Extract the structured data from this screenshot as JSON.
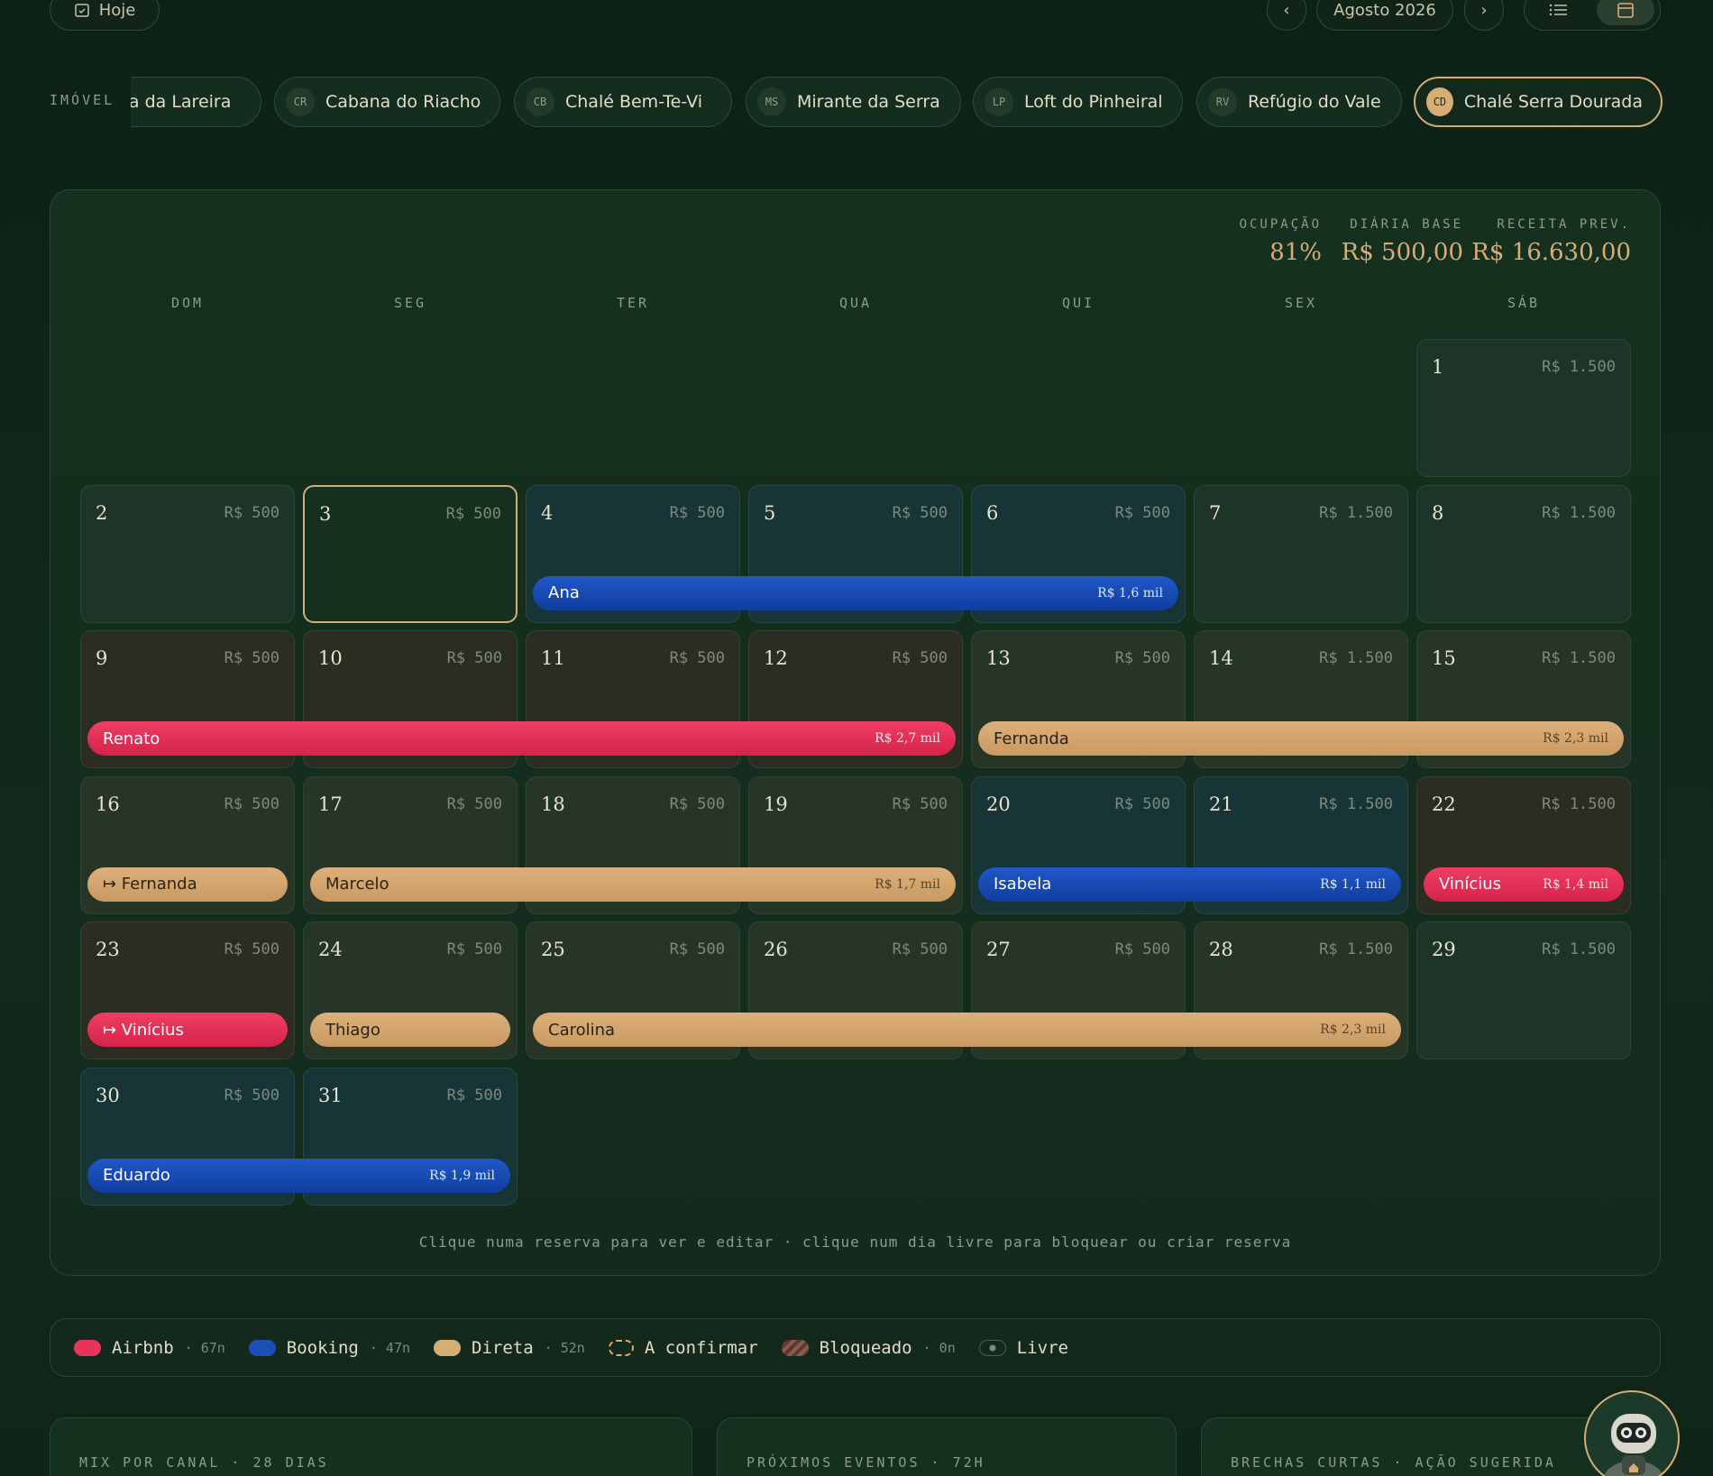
{
  "toolbar": {
    "today_label": "Hoje",
    "month_label": "Agosto 2026",
    "prev_icon": "chevron-left-icon",
    "next_icon": "chevron-right-icon",
    "views": [
      "list-view-icon",
      "calendar-view-icon"
    ]
  },
  "properties": {
    "label": "IMÓVEL",
    "items": [
      {
        "abbr": "",
        "name": "sa da Lareira"
      },
      {
        "abbr": "CR",
        "name": "Cabana do Riacho"
      },
      {
        "abbr": "CB",
        "name": "Chalé Bem-Te-Vi"
      },
      {
        "abbr": "MS",
        "name": "Mirante da Serra"
      },
      {
        "abbr": "LP",
        "name": "Loft do Pinheiral"
      },
      {
        "abbr": "RV",
        "name": "Refúgio do Vale"
      },
      {
        "abbr": "CD",
        "name": "Chalé Serra Dourada",
        "active": true
      }
    ]
  },
  "stats": {
    "occupancy_label": "OCUPAÇÃO",
    "occupancy_value": "81%",
    "base_label": "DIÁRIA BASE",
    "base_value": "R$ 500,00",
    "revenue_label": "RECEITA PREV.",
    "revenue_value": "R$ 16.630,00"
  },
  "weekdays": [
    "DOM",
    "SEG",
    "TER",
    "QUA",
    "QUI",
    "SEX",
    "SÁB"
  ],
  "days": [
    {
      "d": "1",
      "p": "R$ 1.500"
    },
    {
      "d": "2",
      "p": "R$ 500"
    },
    {
      "d": "3",
      "p": "R$ 500"
    },
    {
      "d": "4",
      "p": "R$ 500"
    },
    {
      "d": "5",
      "p": "R$ 500"
    },
    {
      "d": "6",
      "p": "R$ 500"
    },
    {
      "d": "7",
      "p": "R$ 1.500"
    },
    {
      "d": "8",
      "p": "R$ 1.500"
    },
    {
      "d": "9",
      "p": "R$ 500"
    },
    {
      "d": "10",
      "p": "R$ 500"
    },
    {
      "d": "11",
      "p": "R$ 500"
    },
    {
      "d": "12",
      "p": "R$ 500"
    },
    {
      "d": "13",
      "p": "R$ 500"
    },
    {
      "d": "14",
      "p": "R$ 1.500"
    },
    {
      "d": "15",
      "p": "R$ 1.500"
    },
    {
      "d": "16",
      "p": "R$ 500"
    },
    {
      "d": "17",
      "p": "R$ 500"
    },
    {
      "d": "18",
      "p": "R$ 500"
    },
    {
      "d": "19",
      "p": "R$ 500"
    },
    {
      "d": "20",
      "p": "R$ 500"
    },
    {
      "d": "21",
      "p": "R$ 1.500"
    },
    {
      "d": "22",
      "p": "R$ 1.500"
    },
    {
      "d": "23",
      "p": "R$ 500"
    },
    {
      "d": "24",
      "p": "R$ 500"
    },
    {
      "d": "25",
      "p": "R$ 500"
    },
    {
      "d": "26",
      "p": "R$ 500"
    },
    {
      "d": "27",
      "p": "R$ 500"
    },
    {
      "d": "28",
      "p": "R$ 1.500"
    },
    {
      "d": "29",
      "p": "R$ 1.500"
    },
    {
      "d": "30",
      "p": "R$ 500"
    },
    {
      "d": "31",
      "p": "R$ 500"
    }
  ],
  "today_day": "3",
  "bookings": [
    {
      "guest": "Ana",
      "amount": "R$ 1,6 mil",
      "channel": "booking",
      "start": 4,
      "end": 6
    },
    {
      "guest": "Renato",
      "amount": "R$ 2,7 mil",
      "channel": "airbnb",
      "start": 9,
      "end": 12
    },
    {
      "guest": "Fernanda",
      "amount": "R$ 2,3 mil",
      "channel": "direct",
      "start": 13,
      "end": 15
    },
    {
      "guest": "↦ Fernanda",
      "amount": "",
      "channel": "direct",
      "start": 16,
      "end": 16
    },
    {
      "guest": "Marcelo",
      "amount": "R$ 1,7 mil",
      "channel": "direct",
      "start": 17,
      "end": 19
    },
    {
      "guest": "Isabela",
      "amount": "R$ 1,1 mil",
      "channel": "booking",
      "start": 20,
      "end": 21
    },
    {
      "guest": "Vinícius",
      "amount": "R$ 1,4 mil",
      "channel": "airbnb",
      "start": 22,
      "end": 22
    },
    {
      "guest": "↦ Vinícius",
      "amount": "",
      "channel": "airbnb",
      "start": 23,
      "end": 23
    },
    {
      "guest": "Thiago",
      "amount": "",
      "channel": "direct",
      "start": 24,
      "end": 24
    },
    {
      "guest": "Carolina",
      "amount": "R$ 2,3 mil",
      "channel": "direct",
      "start": 25,
      "end": 28
    },
    {
      "guest": "Eduardo",
      "amount": "R$ 1,9 mil",
      "channel": "booking",
      "start": 30,
      "end": 31
    }
  ],
  "hint": "Clique numa reserva para ver e editar · clique num dia livre para bloquear ou criar reserva",
  "legend": [
    {
      "label": "Airbnb",
      "count": "· 67n",
      "color": "#e8335a"
    },
    {
      "label": "Booking",
      "count": "· 47n",
      "color": "#1a4eb8"
    },
    {
      "label": "Direta",
      "count": "· 52n",
      "color": "#d7ad76"
    },
    {
      "label": "A confirmar",
      "count": "",
      "color": "dashed"
    },
    {
      "label": "Bloqueado",
      "count": "· 0n",
      "color": "striped"
    },
    {
      "label": "Livre",
      "count": "",
      "color": "dot"
    }
  ],
  "panels": [
    {
      "title": "MIX POR CANAL · 28 DIAS"
    },
    {
      "title": "PRÓXIMOS EVENTOS · 72H"
    },
    {
      "title": "BRECHAS CURTAS · AÇÃO SUGERIDA"
    }
  ],
  "assistant_icon": "robot-assistant-icon"
}
